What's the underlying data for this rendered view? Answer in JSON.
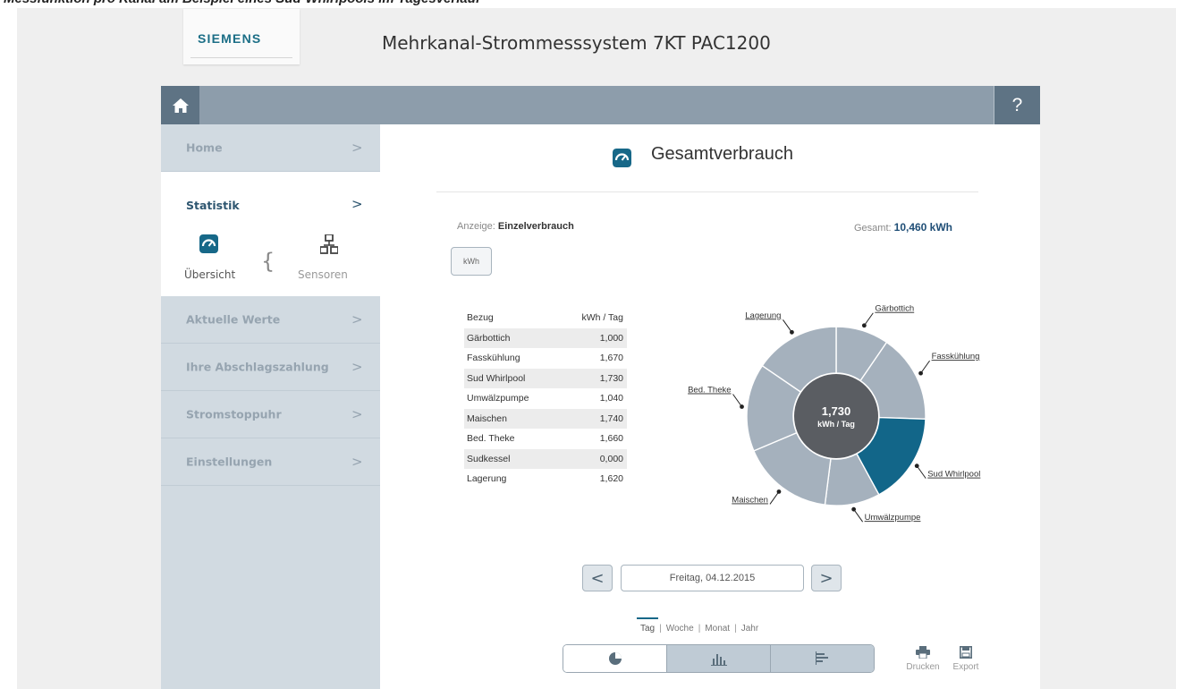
{
  "brand": {
    "logo": "SIEMENS",
    "app_title": "Mehrkanal-Strommesssystem 7KT PAC1200",
    "accent": "#176888"
  },
  "toolbar": {
    "home_icon": "home-icon",
    "help_label": "?"
  },
  "sidebar": {
    "items": [
      {
        "label": "Home",
        "chevron": ">"
      },
      {
        "label": "Statistik",
        "chevron": ">"
      },
      {
        "label": "Aktuelle Werte",
        "chevron": ">"
      },
      {
        "label": "Ihre Abschlagszahlung",
        "chevron": ">"
      },
      {
        "label": "Stromstoppuhr",
        "chevron": ">"
      },
      {
        "label": "Einstellungen",
        "chevron": ">"
      }
    ],
    "subnav": {
      "brace": "{",
      "overview": "Übersicht",
      "sensors": "Sensoren"
    }
  },
  "main": {
    "title": "Gesamtverbrauch",
    "display_label": "Anzeige:",
    "display_value": "Einzelverbrauch",
    "total_label": "Gesamt:",
    "total_value": "10,460 kWh",
    "unit_button": "kWh",
    "table": {
      "headers": [
        "Bezug",
        "kWh / Tag"
      ],
      "rows": [
        {
          "name": "Gärbottich",
          "value": "1,000"
        },
        {
          "name": "Fasskühlung",
          "value": "1,670"
        },
        {
          "name": "Sud Whirlpool",
          "value": "1,730"
        },
        {
          "name": "Umwälzpumpe",
          "value": "1,040"
        },
        {
          "name": "Maischen",
          "value": "1,740"
        },
        {
          "name": "Bed. Theke",
          "value": "1,660"
        },
        {
          "name": "Sudkessel",
          "value": "0,000"
        },
        {
          "name": "Lagerung",
          "value": "1,620"
        }
      ]
    },
    "date": {
      "value": "Freitag, 04.12.2015",
      "prev": "<",
      "next": ">"
    },
    "periods": [
      "Tag",
      "Woche",
      "Monat",
      "Jahr"
    ],
    "period_sep": "|",
    "views": [
      "pie-chart-icon",
      "bar-chart-icon",
      "horizontal-bar-icon"
    ],
    "actions": {
      "print": "Drucken",
      "export": "Export"
    }
  },
  "chart_data": {
    "type": "pie",
    "style": "donut",
    "center_value": "1,730",
    "center_unit": "kWh / Tag",
    "highlighted": "Sud Whirlpool",
    "colors": {
      "slice": "#a5b1bd",
      "highlight": "#126689",
      "center": "#5a5d62"
    },
    "slices": [
      {
        "label": "Gärbottich",
        "value": 1.0
      },
      {
        "label": "Fasskühlung",
        "value": 1.67
      },
      {
        "label": "Sud Whirlpool",
        "value": 1.73
      },
      {
        "label": "Umwälzpumpe",
        "value": 1.04
      },
      {
        "label": "Maischen",
        "value": 1.74
      },
      {
        "label": "Bed. Theke",
        "value": 1.66
      },
      {
        "label": "Lagerung",
        "value": 1.62
      }
    ]
  }
}
